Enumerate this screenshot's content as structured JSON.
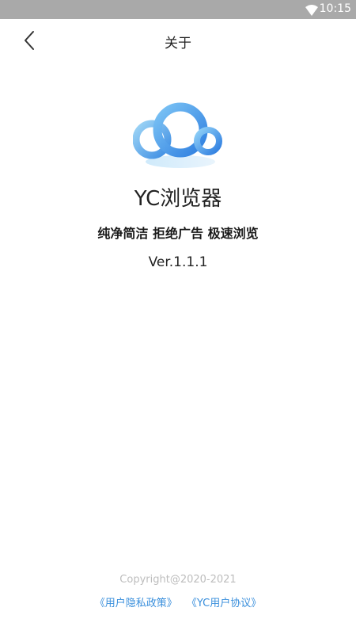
{
  "status_bar": {
    "time": "10:15",
    "wifi_icon": "wifi-icon",
    "background": "#a9a9a9"
  },
  "header": {
    "back_icon": "chevron-left-icon",
    "title": "关于"
  },
  "app": {
    "logo_icon": "cloud-logo-icon",
    "name": "YC浏览器",
    "slogan": "纯净简洁 拒绝广告 极速浏览",
    "version": "Ver.1.1.1",
    "accent_color": "#3a8fdc"
  },
  "footer": {
    "copyright": "Copyright@2020-2021",
    "privacy_link": "《用户隐私政策》",
    "agreement_link": "《YC用户协议》"
  }
}
